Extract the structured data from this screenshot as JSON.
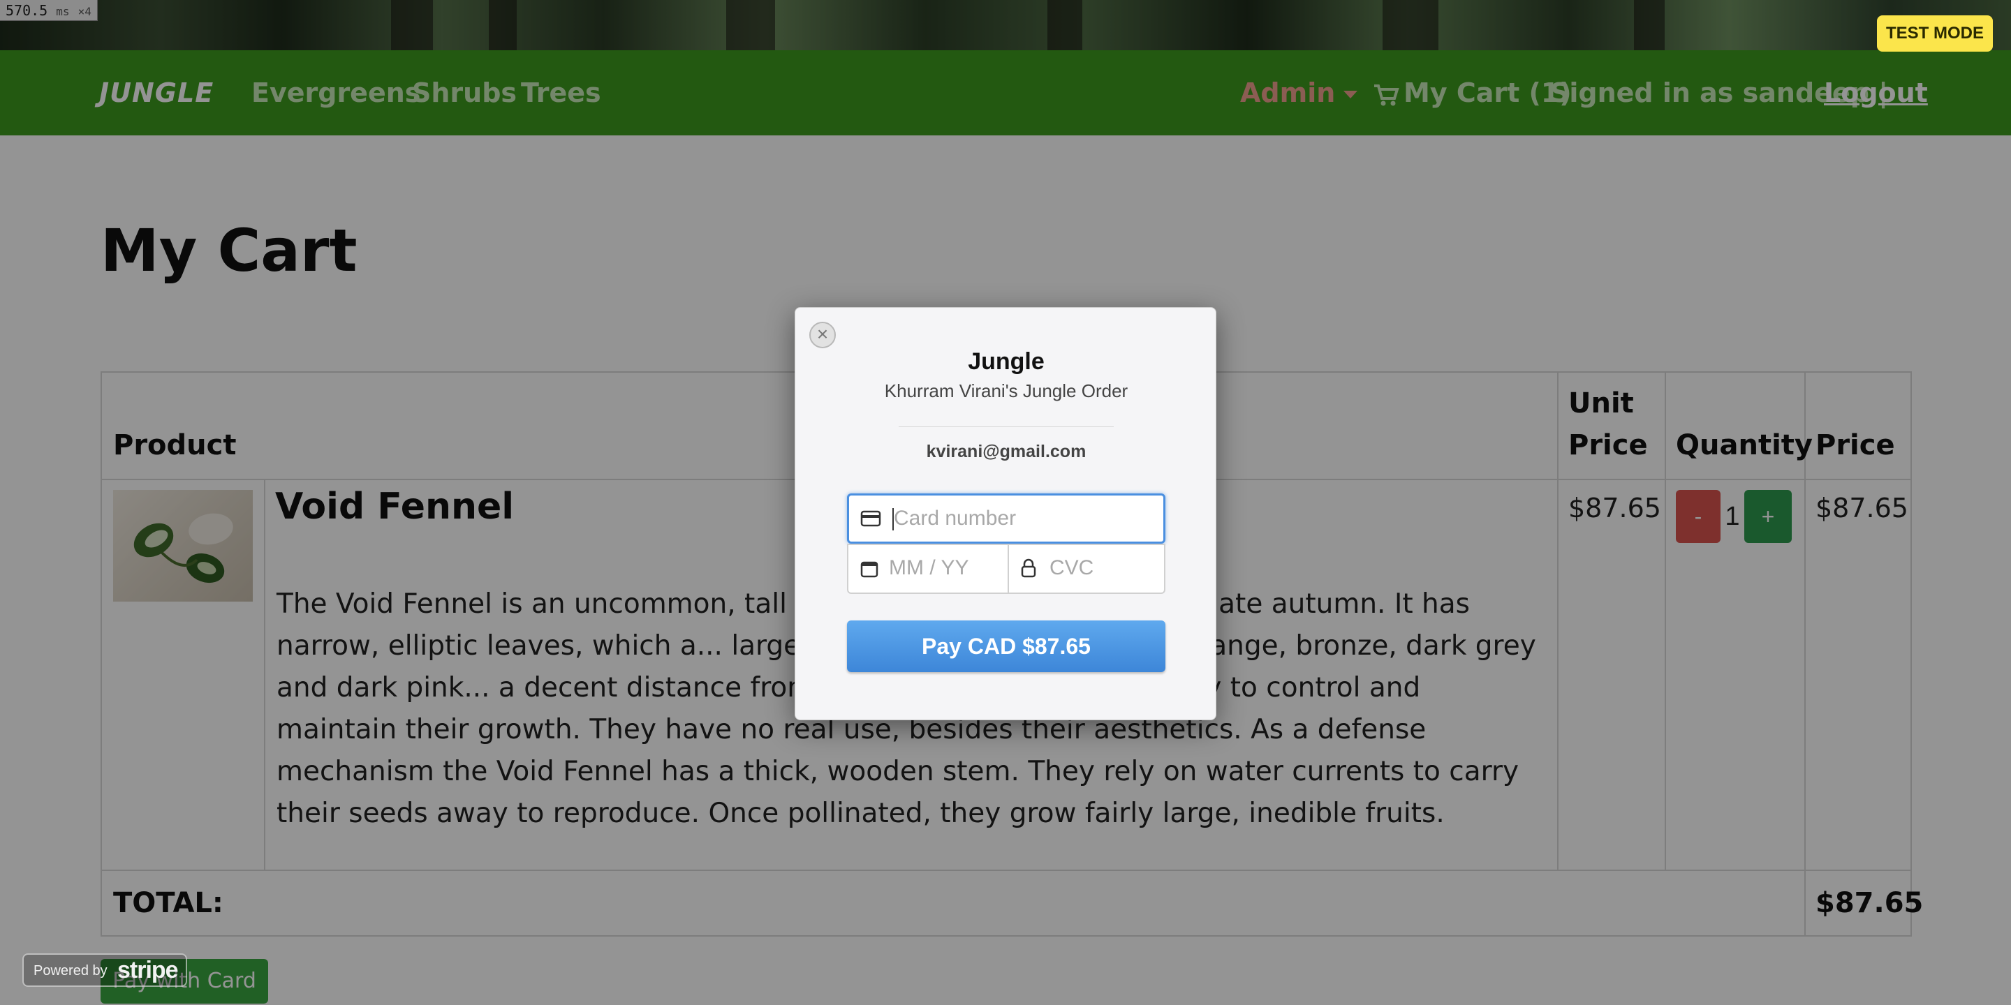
{
  "perf": {
    "value": "570.5",
    "unit": "ms",
    "multiplier": "×4"
  },
  "test_mode": "TEST MODE",
  "nav": {
    "brand": "JUNGLE",
    "links": [
      "Evergreens",
      "Shrubs",
      "Trees"
    ],
    "admin": "Admin",
    "cart": "My Cart (1)",
    "signed_in": "Signed in as sandeep |",
    "logout": "Logout"
  },
  "page_title": "My Cart",
  "table": {
    "headers": {
      "product": "Product",
      "unit_price": "Unit Price",
      "quantity": "Quantity",
      "price": "Price"
    },
    "rows": [
      {
        "name": "Void Fennel",
        "description": "The Void Fennel is an uncommon, tall plant a... regions. It blooms in late autumn. It has narrow, elliptic leaves, which a... large flowers, which can be dark orange, bronze, dark grey and dark pink... a decent distance from each other, but it's very easy to control and maintain their growth. They have no real use, besides their aesthetics. As a defense mechanism the Void Fennel has a thick, wooden stem. They rely on water currents to carry their seeds away to reproduce. Once pollinated, they grow fairly large, inedible fruits.",
        "unit_price": "$87.65",
        "quantity": "1",
        "price": "$87.65",
        "minus_label": "-",
        "plus_label": "+"
      }
    ],
    "total_label": "TOTAL:",
    "total_value": "$87.65"
  },
  "pay_with_card": "Pay with Card",
  "stripe": {
    "close": "×",
    "title": "Jungle",
    "subtitle": "Khurram Virani's Jungle Order",
    "email": "kvirani@gmail.com",
    "card_placeholder": "Card number",
    "expiry_placeholder": "MM / YY",
    "cvc_placeholder": "CVC",
    "pay_button": "Pay CAD $87.65",
    "powered_by": "Powered by",
    "stripe_logo": "stripe"
  },
  "colors": {
    "navbar": "#3d9a1e",
    "pay_button": "#4a97e4",
    "test_mode": "#fbe54b",
    "minus": "#d9534f",
    "plus": "#2e9a4f"
  }
}
